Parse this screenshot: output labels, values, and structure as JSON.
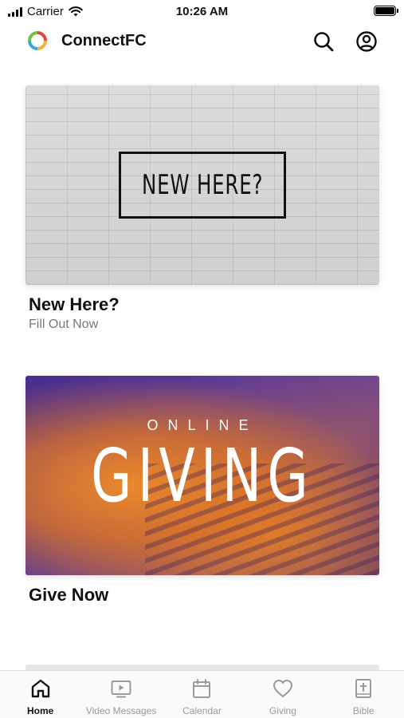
{
  "status_bar": {
    "carrier": "Carrier",
    "time": "10:26 AM"
  },
  "header": {
    "title": "ConnectFC",
    "logo_icon": "connectfc-logo",
    "search_icon": "search-icon",
    "account_icon": "account-icon"
  },
  "cards": [
    {
      "image_text": "NEW HERE?",
      "title": "New Here?",
      "subtitle": "Fill Out Now"
    },
    {
      "image_text_top": "ONLINE",
      "image_text_main": "GIVING",
      "title": "Give Now"
    }
  ],
  "tabs": [
    {
      "label": "Home",
      "icon": "home-icon",
      "active": true
    },
    {
      "label": "Video Messages",
      "icon": "video-icon",
      "active": false
    },
    {
      "label": "Calendar",
      "icon": "calendar-icon",
      "active": false
    },
    {
      "label": "Giving",
      "icon": "heart-icon",
      "active": false
    },
    {
      "label": "Bible",
      "icon": "bible-icon",
      "active": false
    }
  ],
  "colors": {
    "active_tab": "#111111",
    "inactive_tab": "#9a9a9a",
    "giving_purple": "#4a2e8c",
    "giving_orange": "#f08c28"
  }
}
